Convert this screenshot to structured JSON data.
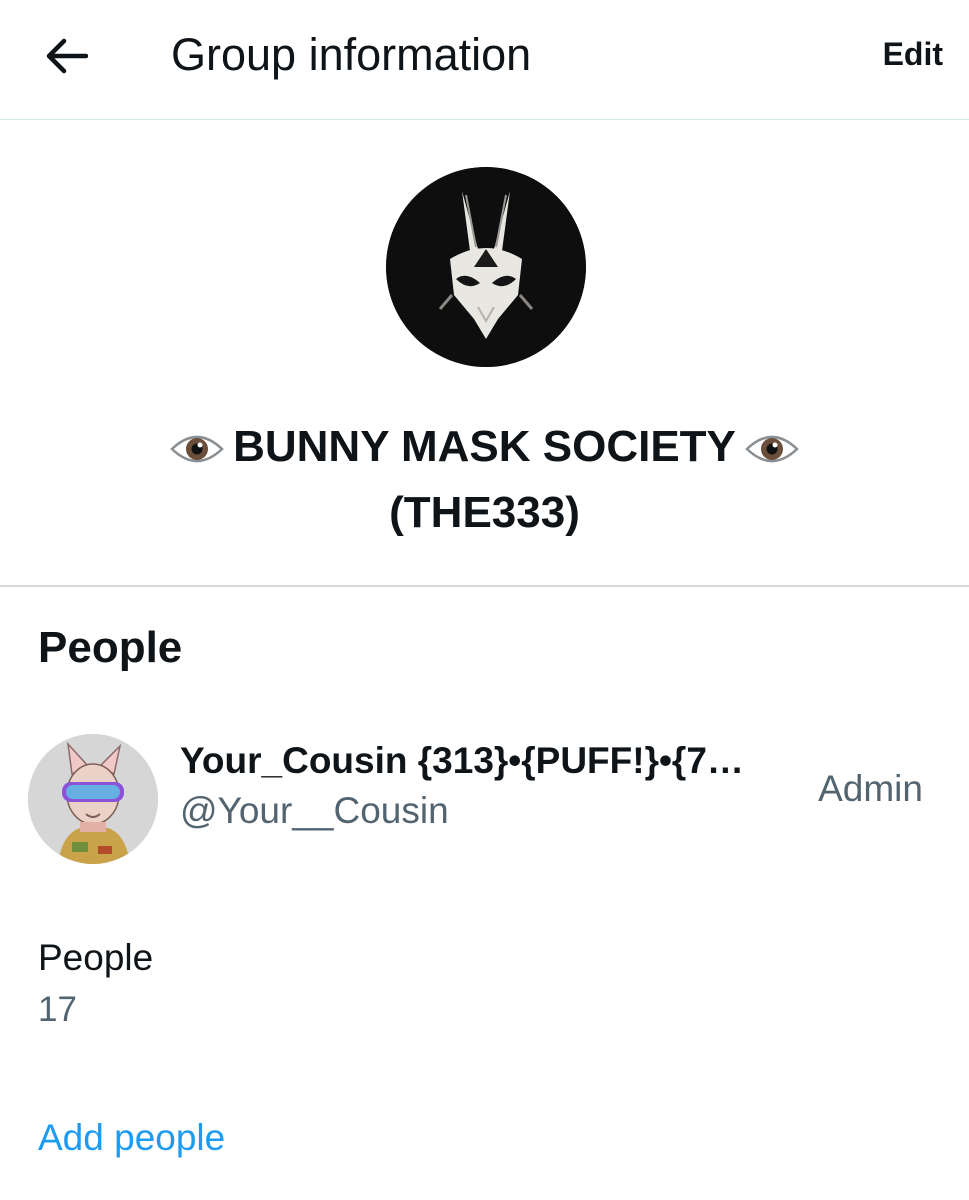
{
  "header": {
    "back_icon": "arrow-left-icon",
    "title": "Group information",
    "edit_label": "Edit"
  },
  "group": {
    "avatar_icon": "bunny-mask-logo",
    "name_line1": "BUNNY MASK SOCIETY",
    "name_line2": "(THE333)",
    "name_emoji": "eye-emoji"
  },
  "people_section": {
    "title": "People",
    "members": [
      {
        "display_name": "Your_Cousin {313}•{PUFF!}•{7…",
        "handle": "@Your__Cousin",
        "role": "Admin"
      }
    ],
    "count_label": "People",
    "count_value": "17",
    "add_people_label": "Add people"
  },
  "colors": {
    "text_primary": "#0f1419",
    "text_secondary": "#536471",
    "link": "#1d9bf0",
    "divider": "#d4d8db"
  }
}
